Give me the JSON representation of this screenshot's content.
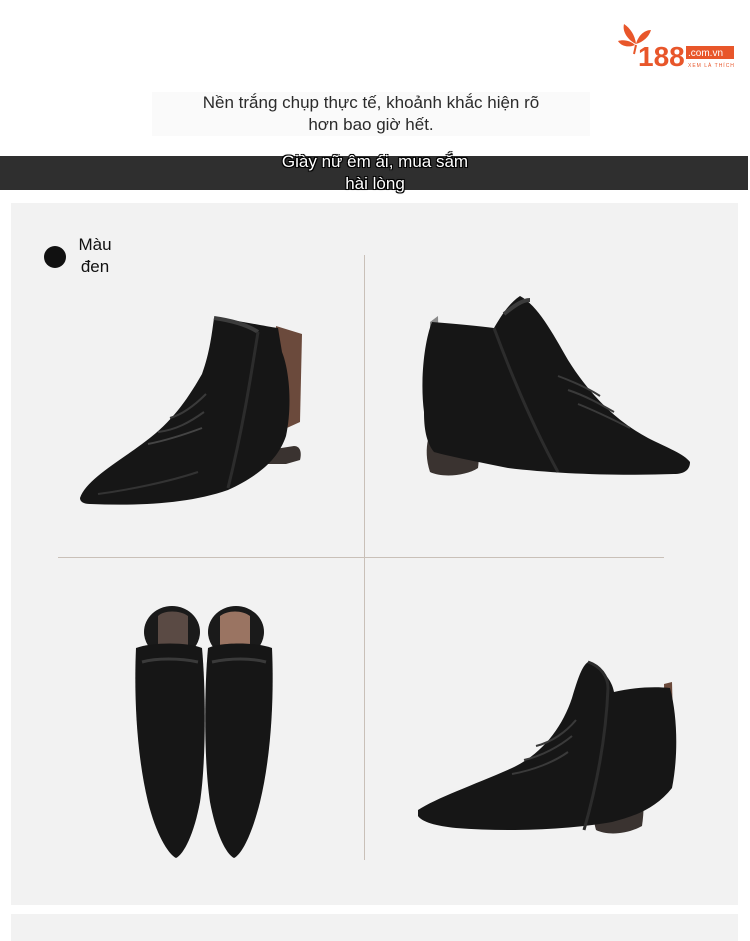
{
  "logo": {
    "number": "188",
    "domain": ".com.vn",
    "tagline": "XEM LÀ THÍCH",
    "brand_color": "#e8562a"
  },
  "intro": {
    "line1": "Nền trắng chụp thực tế, khoảnh khắc hiện rõ",
    "line2": "hơn bao giờ hết."
  },
  "banner": {
    "line1": "Giày nữ êm ái, mua sắm",
    "line2": "hài lòng"
  },
  "swatch": {
    "color": "#111111",
    "label_line1": "Màu",
    "label_line2": "đen"
  },
  "product_views": [
    {
      "view": "side-left"
    },
    {
      "view": "side-right"
    },
    {
      "view": "top"
    },
    {
      "view": "three-quarter"
    }
  ]
}
